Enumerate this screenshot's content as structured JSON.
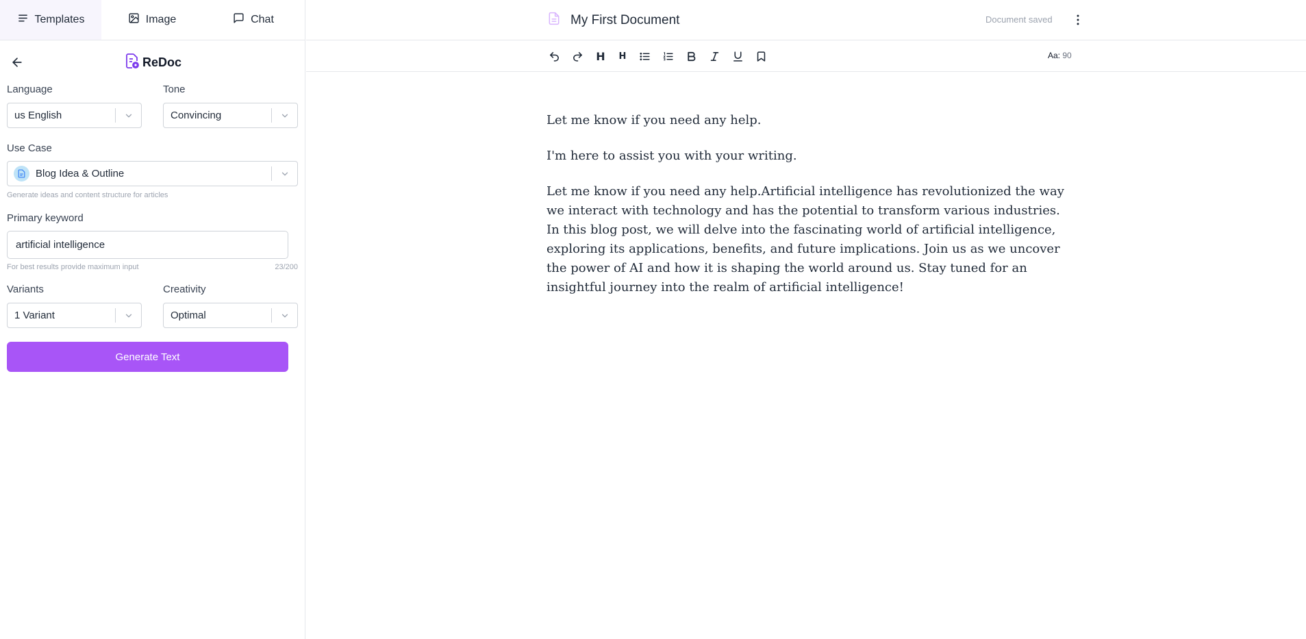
{
  "tabs": [
    {
      "label": "Templates",
      "icon": "align-left-icon",
      "active": true
    },
    {
      "label": "Image",
      "icon": "image-icon",
      "active": false
    },
    {
      "label": "Chat",
      "icon": "chat-bubble-icon",
      "active": false
    }
  ],
  "brand": {
    "name": "ReDoc",
    "accent": "#7c3aed"
  },
  "form": {
    "language": {
      "label": "Language",
      "value": "us English"
    },
    "tone": {
      "label": "Tone",
      "value": "Convincing"
    },
    "use_case": {
      "label": "Use Case",
      "value": "Blog Idea & Outline",
      "helper": "Generate ideas and content structure for articles"
    },
    "primary_keyword": {
      "label": "Primary keyword",
      "value": "artificial intelligence",
      "helper": "For best results provide maximum input",
      "counter": "23/200"
    },
    "variants": {
      "label": "Variants",
      "value": "1 Variant"
    },
    "creativity": {
      "label": "Creativity",
      "value": "Optimal"
    },
    "generate_label": "Generate Text",
    "button_color": "#a855f7"
  },
  "document": {
    "title": "My First Document",
    "status": "Document saved",
    "font_size_label": "Aa:",
    "font_size_value": "90",
    "paragraphs": [
      "Let me know if you need any help.",
      "I'm here to assist you with your writing.",
      "Let me know if you need any help.Artificial intelligence has revolutionized the way we interact with technology and has the potential to transform various industries. In this blog post, we will delve into the fascinating world of artificial intelligence, exploring its applications, benefits, and future implications. Join us as we uncover the power of AI and how it is shaping the world around us. Stay tuned for an insightful journey into the realm of artificial intelligence!"
    ]
  },
  "toolbar": {
    "buttons": [
      "undo-icon",
      "redo-icon",
      "heading-1-icon",
      "heading-2-icon",
      "bullet-list-icon",
      "numbered-list-icon",
      "bold-icon",
      "italic-icon",
      "underline-icon",
      "bookmark-icon"
    ],
    "h1": "H",
    "h2": "H"
  }
}
